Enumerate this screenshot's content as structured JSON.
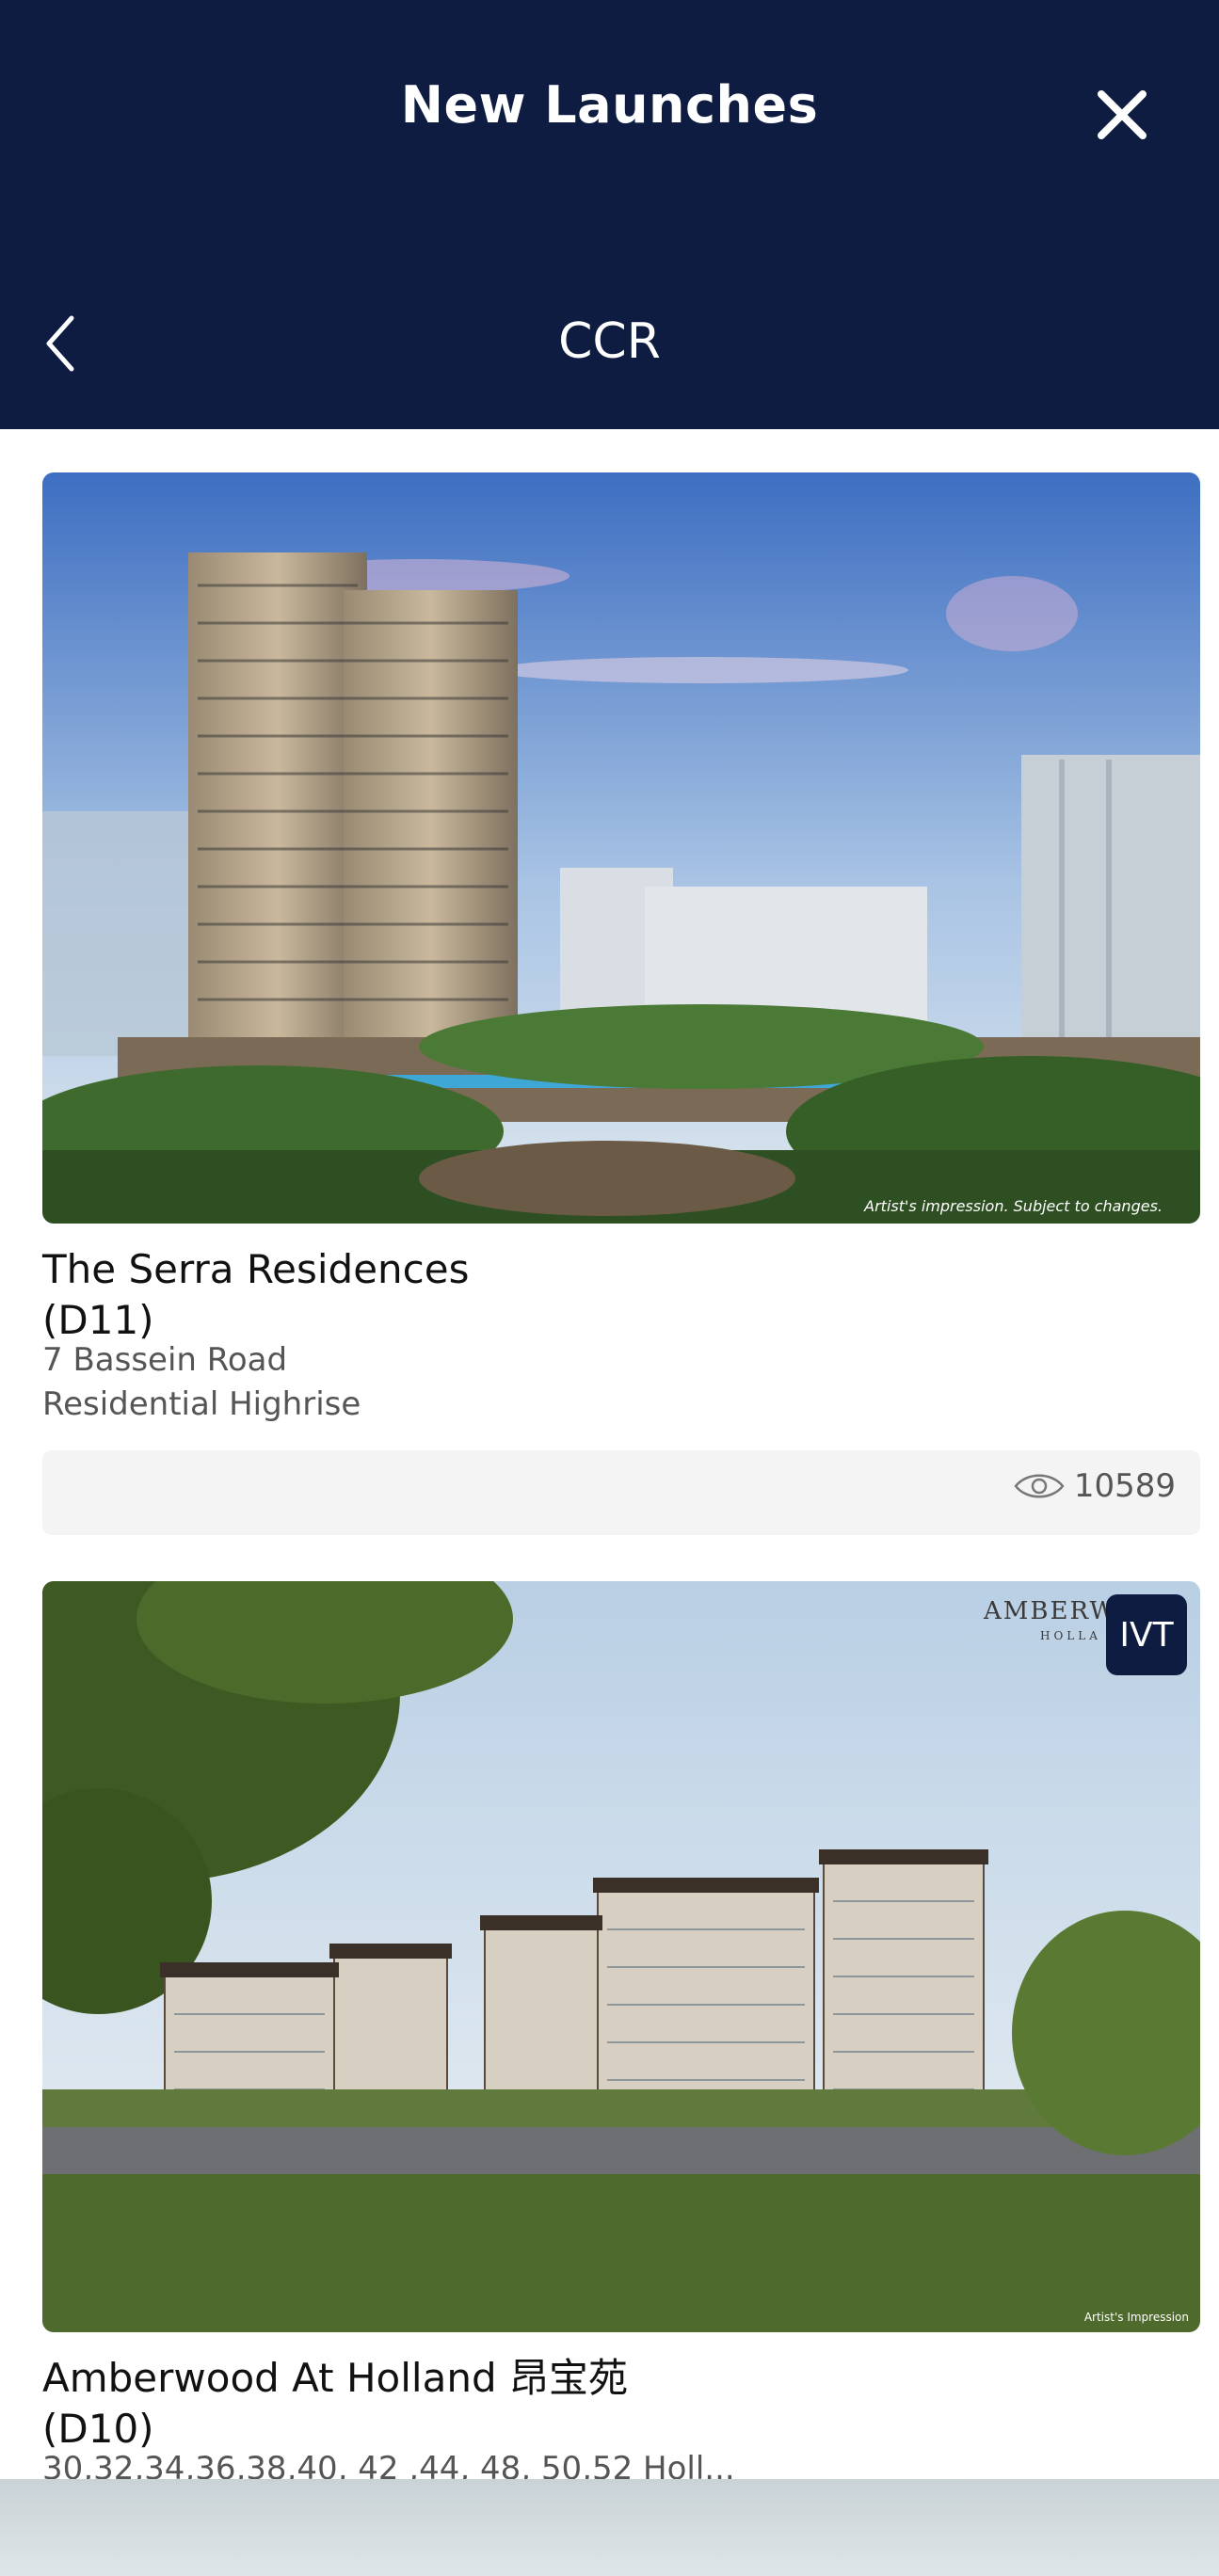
{
  "header": {
    "title": "New Launches",
    "subtitle": "CCR",
    "close_icon": "close-icon",
    "back_icon": "chevron-left-icon"
  },
  "listings": [
    {
      "name": "The Serra Residences",
      "district": "(D11)",
      "address": "7 Bassein Road",
      "type": "Residential Highrise",
      "views": "10589",
      "image_caption": "Artist's impression. Subject to changes."
    },
    {
      "name": "Amberwood At Holland 昂宝苑",
      "district": "(D10)",
      "address": "30,32,34,36,38,40, 42 ,44, 48, 50,52 Holl...",
      "badge": "IVT",
      "image_logo_top": "AMBERW",
      "image_logo_bottom": "HOLLA",
      "image_caption": "Artist's Impression"
    }
  ],
  "colors": {
    "header_bg": "#0e1c41",
    "badge_bg": "#0e1c41",
    "views_bar_bg": "#f4f4f4"
  }
}
